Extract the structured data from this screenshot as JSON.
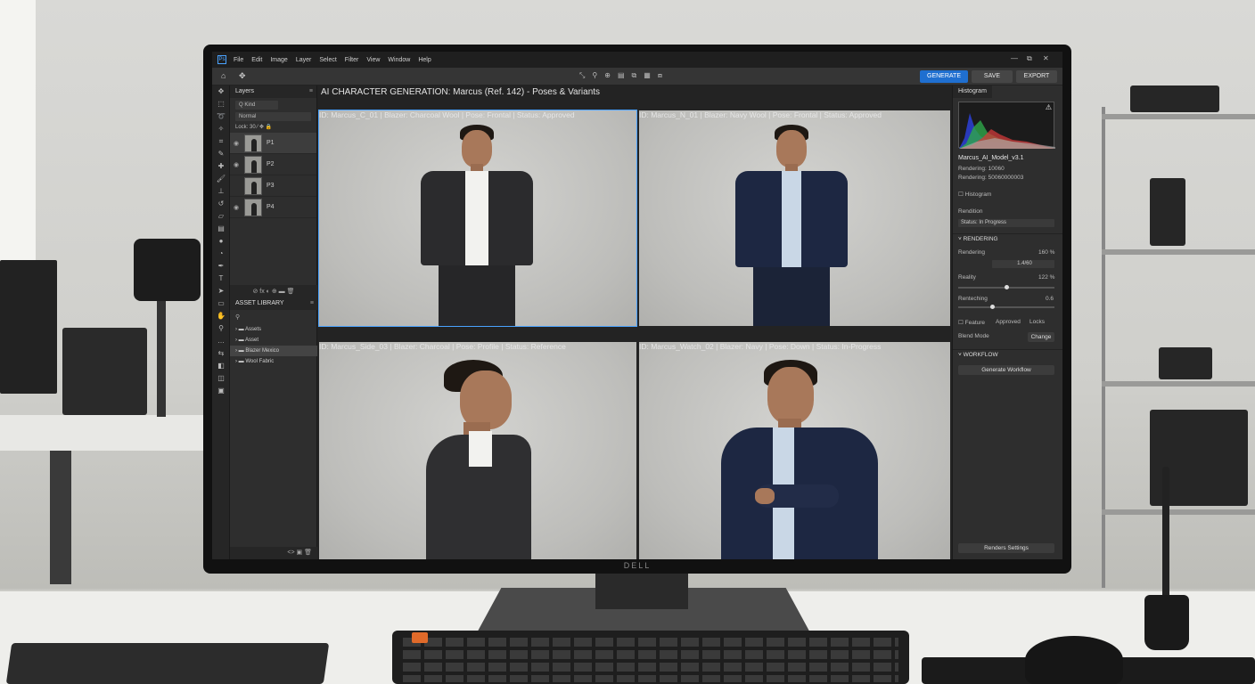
{
  "menubar": {
    "items": [
      "File",
      "Edit",
      "Image",
      "Layer",
      "Select",
      "Filter",
      "View",
      "Window",
      "Help"
    ],
    "win_controls": [
      "—",
      "⧉",
      "✕"
    ]
  },
  "optbar": {
    "generate_label": "GENERATE",
    "save_label": "SAVE",
    "export_label": "EXPORT",
    "tools": [
      "⤡",
      "⚲",
      "⊕",
      "▤",
      "⧉",
      "▦",
      "⧈"
    ]
  },
  "layers_panel": {
    "tab": "Layers",
    "kind_filter": "Q Kind",
    "blend_mode": "Normal",
    "lock_row": "Lock: 30  ⁄  ✥  🔒",
    "layers": [
      {
        "name": "P1"
      },
      {
        "name": "P2"
      },
      {
        "name": "P3"
      },
      {
        "name": "P4"
      }
    ],
    "footer_icons": "⊘  fx  ◐  ⊕  ▬  🗑"
  },
  "asset_library": {
    "tab": "ASSET LIBRARY",
    "search_icon_label": "⚲",
    "items": [
      "Assets",
      "Asset",
      "Blazer Mexico",
      "Wool Fabric"
    ],
    "footer": "<>  ▣  🗑"
  },
  "canvas": {
    "title": "AI CHARACTER GENERATION: Marcus (Ref. 142) - Poses & Variants",
    "tiles": [
      {
        "label": "ID: Marcus_C_01 | Blazer: Charcoal Wool | Pose: Frontal | Status: Approved"
      },
      {
        "label": "ID: Marcus_N_01 | Blazer: Navy Wool | Pose: Frontal | Status: Approved"
      },
      {
        "label": "ID: Marcus_Side_03 | Blazer: Charcoal | Pose: Profile | Status: Reference"
      },
      {
        "label": "ID: Marcus_Watch_02 | Blazer: Navy | Pose: Down | Status: In-Progress"
      }
    ]
  },
  "right_panel": {
    "histogram_tab": "Histogram",
    "warning_icon": "⚠",
    "model_name": "Marcus_AI_Model_v3.1",
    "rendering_line1": "Rendering: 10060",
    "rendering_line2": "Rendering: 50060000003",
    "histogram_check": "Histogram",
    "rendition_label": "Rendition",
    "status_select": "Status: In Progress",
    "section_rendering": "RENDERING",
    "rendering_label": "Rendering",
    "rendering_value": "160 %",
    "rendering_field": "1.4/60",
    "reality_label": "Reality",
    "reality_value": "122 %",
    "reality_level": 0.5,
    "rendering2_label": "Renteching",
    "rendering2_value": "0.6",
    "rendering2_level": 0.35,
    "row_feature": "Feature",
    "row_approved": "Approved",
    "row_locks": "Locks",
    "blend_mode_label": "Blend Mode",
    "change_button": "Change",
    "section_workflow": "WORKFLOW",
    "generate_workflow": "Generate Workflow",
    "render_settings": "Renders Settings"
  },
  "monitor_brand": "DELL",
  "colors": {
    "accent": "#1f6fd0",
    "selection": "#4aa3ff",
    "charcoal_blazer": "#2b2b2d",
    "navy_blazer": "#1d2742"
  }
}
